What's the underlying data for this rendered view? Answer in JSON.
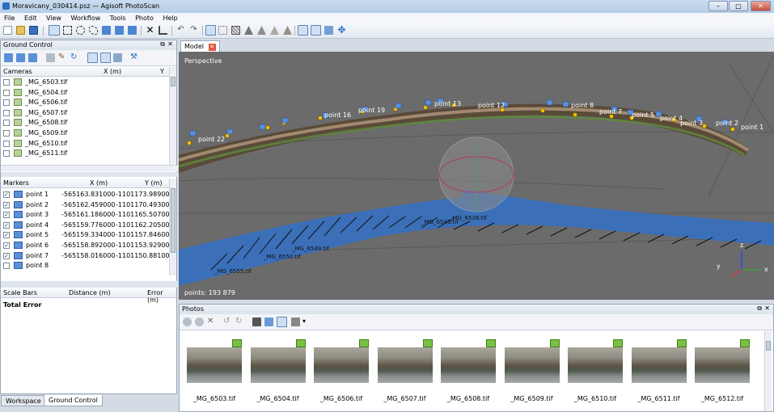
{
  "window": {
    "title": "Moravicany_030414.psz — Agisoft PhotoScan",
    "minimize": "–",
    "maximize": "□",
    "close": "✕"
  },
  "menu": [
    "File",
    "Edit",
    "View",
    "Workflow",
    "Tools",
    "Photo",
    "Help"
  ],
  "ground_control": {
    "title": "Ground Control",
    "cameras_header": {
      "col1": "Cameras",
      "col2": "X (m)",
      "col3": "Y"
    },
    "cameras": [
      "_MG_6503.tif",
      "_MG_6504.tif",
      "_MG_6506.tif",
      "_MG_6507.tif",
      "_MG_6508.tif",
      "_MG_6509.tif",
      "_MG_6510.tif",
      "_MG_6511.tif"
    ],
    "markers_header": {
      "col1": "Markers",
      "col2": "X (m)",
      "col3": "Y (m)"
    },
    "markers": [
      {
        "name": "point 1",
        "x": "-565163.831000",
        "y": "-1101173.989000",
        "checked": true
      },
      {
        "name": "point 2",
        "x": "-565162.459000",
        "y": "-1101170.493000",
        "checked": true
      },
      {
        "name": "point 3",
        "x": "-565161.186000",
        "y": "-1101165.507000",
        "checked": true
      },
      {
        "name": "point 4",
        "x": "-565159.776000",
        "y": "-1101162.205000",
        "checked": true
      },
      {
        "name": "point 5",
        "x": "-565159.334000",
        "y": "-1101157.846000",
        "checked": true
      },
      {
        "name": "point 6",
        "x": "-565158.892000",
        "y": "-1101153.929000",
        "checked": true
      },
      {
        "name": "point 7",
        "x": "-565158.016000",
        "y": "-1101150.881000",
        "checked": true
      },
      {
        "name": "point 8",
        "x": "",
        "y": "",
        "checked": false
      }
    ],
    "scalebars_header": {
      "col1": "Scale Bars",
      "col2": "Distance (m)",
      "col3": "Error (m)"
    },
    "total_error": "Total Error"
  },
  "model": {
    "tab_label": "Model",
    "view_mode": "Perspective",
    "points_count": "points: 193 879",
    "axis_y": "y",
    "axis_x": "x",
    "axis_z": "z",
    "point_labels": [
      "point 1",
      "point 2",
      "point 3",
      "point 4",
      "point 5",
      "point 7",
      "point 8",
      "point 12",
      "point 13",
      "point 16",
      "point 19",
      "point 22"
    ],
    "camera_labels": [
      "_MG_6538.tif",
      "_MG_6546.tif",
      "_MG_6555.tif",
      "_MG_6550.tif",
      "_MG_6549.tif"
    ]
  },
  "photos": {
    "title": "Photos",
    "items": [
      "_MG_6503.tif",
      "_MG_6504.tif",
      "_MG_6506.tif",
      "_MG_6507.tif",
      "_MG_6508.tif",
      "_MG_6509.tif",
      "_MG_6510.tif",
      "_MG_6511.tif",
      "_MG_6512.tif"
    ]
  },
  "bottom_tabs": [
    "Workspace",
    "Ground Control"
  ],
  "colors": {
    "accent": "#3b6fb8",
    "marker_flag": "#5b8fd8",
    "photo_flag": "#7cc043",
    "point_dot": "#f2c200",
    "water": "#3b6fb8"
  }
}
